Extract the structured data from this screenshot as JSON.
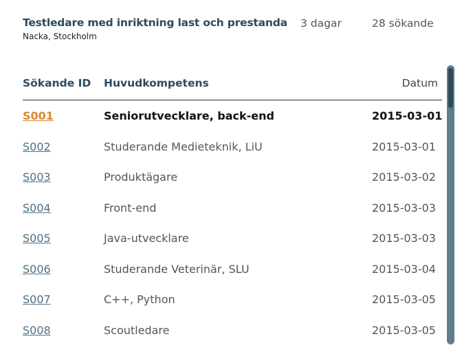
{
  "job": {
    "title": "Testledare med inriktning last och prestanda",
    "location": "Nacka, Stockholm",
    "age": "3 dagar",
    "applicants": "28 sökande"
  },
  "table": {
    "headers": {
      "id": "Sökande ID",
      "competence": "Huvudkompetens",
      "date": "Datum"
    },
    "rows": [
      {
        "id": "S001",
        "competence": "Seniorutvecklare, back-end",
        "date": "2015-03-01",
        "active": true
      },
      {
        "id": "S002",
        "competence": "Studerande Medieteknik, LiU",
        "date": "2015-03-01"
      },
      {
        "id": "S003",
        "competence": "Produktägare",
        "date": "2015-03-02"
      },
      {
        "id": "S004",
        "competence": "Front-end",
        "date": "2015-03-03"
      },
      {
        "id": "S005",
        "competence": "Java-utvecklare",
        "date": "2015-03-03"
      },
      {
        "id": "S006",
        "competence": "Studerande Veterinär, SLU",
        "date": "2015-03-04"
      },
      {
        "id": "S007",
        "competence": "C++, Python",
        "date": "2015-03-05"
      },
      {
        "id": "S008",
        "competence": "Scoutledare",
        "date": "2015-03-05"
      }
    ]
  },
  "colors": {
    "heading": "#2e4a5c",
    "link": "#4f6f82",
    "active_link": "#d9882f",
    "scrollbar_track": "#5f7d8d",
    "scrollbar_thumb": "#2e4a5c"
  }
}
